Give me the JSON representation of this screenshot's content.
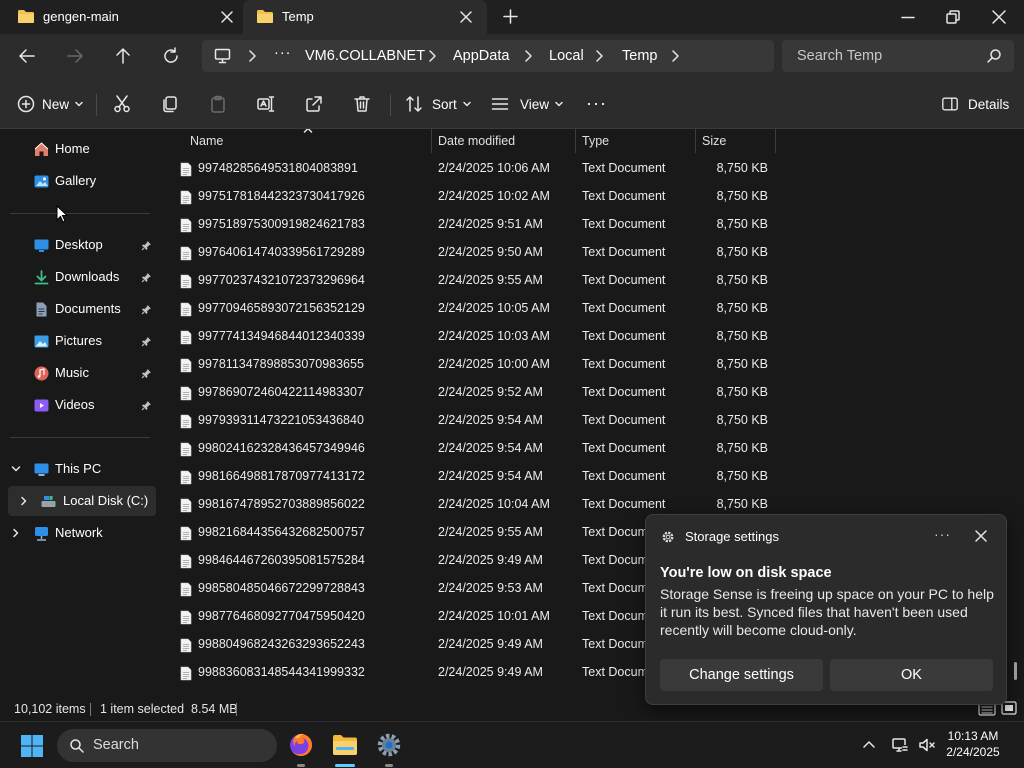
{
  "tabs": [
    {
      "label": "gengen-main",
      "active": false
    },
    {
      "label": "Temp",
      "active": true
    }
  ],
  "window_controls": [
    "minimize-icon",
    "restore-icon",
    "close-icon"
  ],
  "nav": {
    "back": "back-arrow-icon",
    "forward": "forward-arrow-icon",
    "up": "up-arrow-icon",
    "refresh": "refresh-icon"
  },
  "breadcrumb": {
    "more": "···",
    "items": [
      "VM6.COLLABNET",
      "AppData",
      "Local",
      "Temp"
    ]
  },
  "search": {
    "placeholder": "Search Temp"
  },
  "toolbar": {
    "new_label": "New",
    "sort_label": "Sort",
    "view_label": "View",
    "more": "···",
    "details_label": "Details",
    "icons": [
      "cut-icon",
      "copy-icon",
      "paste-icon",
      "rename-icon",
      "share-icon",
      "delete-icon"
    ]
  },
  "sidebar": {
    "top": [
      {
        "label": "Home",
        "icon": "home-icon"
      },
      {
        "label": "Gallery",
        "icon": "gallery-icon"
      }
    ],
    "pinned": [
      {
        "label": "Desktop",
        "icon": "desktop-icon",
        "color": "#2f8fe6"
      },
      {
        "label": "Downloads",
        "icon": "downloads-icon",
        "color": "#3fbf8a"
      },
      {
        "label": "Documents",
        "icon": "documents-icon",
        "color": "#8ea0b8"
      },
      {
        "label": "Pictures",
        "icon": "pictures-icon",
        "color": "#3a9be6"
      },
      {
        "label": "Music",
        "icon": "music-icon",
        "color": "#e0645a"
      },
      {
        "label": "Videos",
        "icon": "videos-icon",
        "color": "#8b5cf6"
      }
    ],
    "tree": [
      {
        "label": "This PC",
        "icon": "this-pc-icon",
        "expanded": true
      },
      {
        "label": "Local Disk (C:)",
        "icon": "local-disk-icon",
        "expanded": false,
        "selected": true
      },
      {
        "label": "Network",
        "icon": "network-icon",
        "expanded": false
      }
    ]
  },
  "columns": [
    "Name",
    "Date modified",
    "Type",
    "Size"
  ],
  "files": [
    {
      "name": "9974828564953180408389​1",
      "date": "2/24/2025 10:06 AM",
      "type": "Text Document",
      "size": "8,750 KB"
    },
    {
      "name": "99751781844232373041792​6",
      "date": "2/24/2025 10:02 AM",
      "type": "Text Document",
      "size": "8,750 KB"
    },
    {
      "name": "99751897530091982462178​3",
      "date": "2/24/2025 9:51 AM",
      "type": "Text Document",
      "size": "8,750 KB"
    },
    {
      "name": "99764061474033956172928​9",
      "date": "2/24/2025 9:50 AM",
      "type": "Text Document",
      "size": "8,750 KB"
    },
    {
      "name": "99770237432107237329696​4",
      "date": "2/24/2025 9:55 AM",
      "type": "Text Document",
      "size": "8,750 KB"
    },
    {
      "name": "99770946589307215635212​9",
      "date": "2/24/2025 10:05 AM",
      "type": "Text Document",
      "size": "8,750 KB"
    },
    {
      "name": "99777413494684401234033​9",
      "date": "2/24/2025 10:03 AM",
      "type": "Text Document",
      "size": "8,750 KB"
    },
    {
      "name": "99781134789885307098365​5",
      "date": "2/24/2025 10:00 AM",
      "type": "Text Document",
      "size": "8,750 KB"
    },
    {
      "name": "99786907246042211498330​7",
      "date": "2/24/2025 9:52 AM",
      "type": "Text Document",
      "size": "8,750 KB"
    },
    {
      "name": "99793931147322105343684​0",
      "date": "2/24/2025 9:54 AM",
      "type": "Text Document",
      "size": "8,750 KB"
    },
    {
      "name": "99802416232843645734994​6",
      "date": "2/24/2025 9:54 AM",
      "type": "Text Document",
      "size": "8,750 KB"
    },
    {
      "name": "99816649881787097741317​2",
      "date": "2/24/2025 9:54 AM",
      "type": "Text Document",
      "size": "8,750 KB"
    },
    {
      "name": "99816747895270388985602​2",
      "date": "2/24/2025 10:04 AM",
      "type": "Text Document",
      "size": "8,750 KB"
    },
    {
      "name": "99821684435643268250075​7",
      "date": "2/24/2025 9:55 AM",
      "type": "Text Document",
      "size": ""
    },
    {
      "name": "99846446726039508157528​4",
      "date": "2/24/2025 9:49 AM",
      "type": "Text Document",
      "size": ""
    },
    {
      "name": "99858048504667229972884​3",
      "date": "2/24/2025 9:53 AM",
      "type": "Text Document",
      "size": ""
    },
    {
      "name": "99877646809277047595042​0",
      "date": "2/24/2025 10:01 AM",
      "type": "Text Document",
      "size": ""
    },
    {
      "name": "99880496824326329365224​3",
      "date": "2/24/2025 9:49 AM",
      "type": "Text Document",
      "size": ""
    },
    {
      "name": "99883608314854434199933​2",
      "date": "2/24/2025 9:49 AM",
      "type": "Text Document",
      "size": ""
    }
  ],
  "status": {
    "items": "10,102 items",
    "selected": "1 item selected  8.54 MB"
  },
  "toast": {
    "app": "Storage settings",
    "more": "···",
    "title": "You're low on disk space",
    "body": "Storage Sense is freeing up space on your PC to help it run its best. Synced files that haven't been used recently will become cloud-only.",
    "primary_label": "Change settings",
    "secondary_label": "OK"
  },
  "taskbar": {
    "search_placeholder": "Search",
    "apps": [
      "firefox-icon",
      "file-explorer-icon",
      "settings-icon"
    ]
  },
  "clock": {
    "time": "10:13 AM",
    "date": "2/24/2025"
  },
  "colors": {
    "accent": "#60cdff",
    "folder": "#f2c14e",
    "taskbar": "#1c1c1c"
  }
}
